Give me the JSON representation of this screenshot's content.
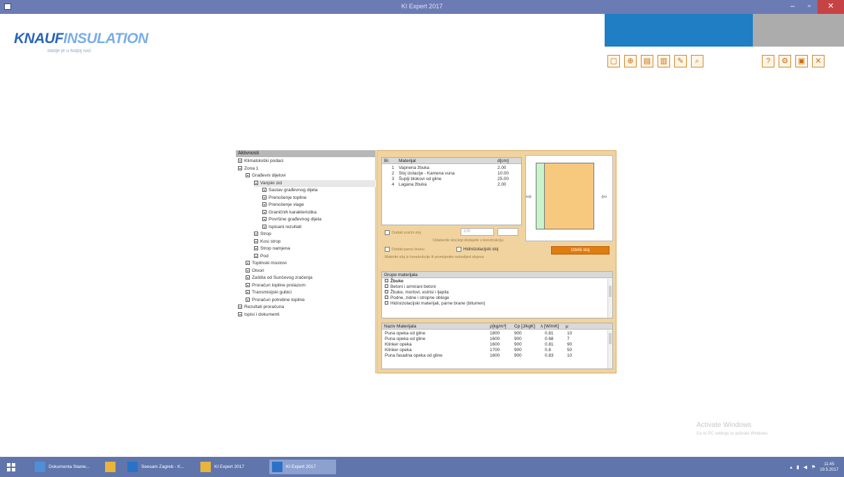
{
  "window": {
    "title": "KI Expert 2017",
    "min_glyph": "–",
    "max_glyph": "▫",
    "close_glyph": "✕"
  },
  "logo": {
    "brand_bold": "KNAUF",
    "brand_light": "INSULATION",
    "tagline": "swoje je u tvojoj ruci"
  },
  "toolbar": {
    "group1": [
      {
        "name": "new-icon",
        "glyph": "▢"
      },
      {
        "name": "open-icon",
        "glyph": "⊕"
      },
      {
        "name": "save-icon",
        "glyph": "▤"
      },
      {
        "name": "save-as-icon",
        "glyph": "▥"
      },
      {
        "name": "edit-icon",
        "glyph": "✎"
      },
      {
        "name": "preview-icon",
        "glyph": "⌕"
      }
    ],
    "group2": [
      {
        "name": "help-icon",
        "glyph": "?"
      },
      {
        "name": "settings-icon",
        "glyph": "⚙"
      },
      {
        "name": "pdf-icon",
        "glyph": "▣"
      },
      {
        "name": "exit-icon",
        "glyph": "✕"
      }
    ]
  },
  "tree": {
    "root": "Aktivnosti",
    "items": [
      {
        "label": "Klimatološki podaci",
        "level": 1
      },
      {
        "label": "Zona 1",
        "level": 1
      },
      {
        "label": "Građevni dijelovi",
        "level": 2
      },
      {
        "label": "Vanjski zid",
        "level": 3,
        "selected": true
      },
      {
        "label": "Sastav građevnog dijela",
        "level": 4
      },
      {
        "label": "Prenošenje topline",
        "level": 4
      },
      {
        "label": "Prenošenje vlage",
        "level": 4
      },
      {
        "label": "Graničnih karakteristika",
        "level": 4
      },
      {
        "label": "Površine građevnog dijela",
        "level": 4
      },
      {
        "label": "Ispisani rezultati",
        "level": 4
      },
      {
        "label": "Strop",
        "level": 3
      },
      {
        "label": "Kosi strop",
        "level": 3
      },
      {
        "label": "Strop namjena",
        "level": 3
      },
      {
        "label": "Pod",
        "level": 3
      },
      {
        "label": "Toplinski mostovi",
        "level": 2
      },
      {
        "label": "Otvori",
        "level": 2
      },
      {
        "label": "Zaštita od Sunčevog zračenja",
        "level": 2
      },
      {
        "label": "Proračun topline prolazom",
        "level": 2
      },
      {
        "label": "Transmisijski gubici",
        "level": 2
      },
      {
        "label": "Proračun potrebne topline",
        "level": 2
      },
      {
        "label": "Rezultati proračuna",
        "level": 1
      },
      {
        "label": "Ispisi i dokumenti",
        "level": 1
      }
    ]
  },
  "layers": {
    "headers": {
      "no": "Br.",
      "material": "Materijal",
      "thickness": "d[cm]"
    },
    "rows": [
      {
        "no": "1",
        "material": "Vapnena žbuka",
        "thickness": "2.00"
      },
      {
        "no": "2",
        "material": "Sloj izolacije - Kamena vuna",
        "thickness": "10.00"
      },
      {
        "no": "3",
        "material": "Šuplji blokovi od gline",
        "thickness": "25.00"
      },
      {
        "no": "4",
        "material": "Lagana žbuka",
        "thickness": "2.00"
      }
    ]
  },
  "options": {
    "option1": "Dodati zračni sloj",
    "option1_value": "100",
    "note1": "Odaberite sloj koji dodajete u konstrukciju",
    "option2": "Dodati parnu branu",
    "option3": "Hidroizolacijski sloj",
    "note2": "Maknite sloj iz konstrukcije ili promijenite redoslijed slojeva",
    "button": "Izbriši sloj"
  },
  "groups": {
    "header": "Grupe materijala",
    "items": [
      "Žbuke",
      "Betoni i armirani betoni",
      "Žbuke, mortovi, estrisi i ljepila",
      "Podne, zidne i stropne obloge",
      "Hidroizolacijski materijali, parne brane (bitumen)"
    ]
  },
  "materials": {
    "headers": {
      "name": "Naziv Materijala",
      "rho": "ρ[kg/m³]",
      "c": "Cp [J/kgK]",
      "lambda": "λ [W/mK]",
      "mu": "μ"
    },
    "rows": [
      {
        "name": "Puna opeka od gline",
        "rho": "1800",
        "c": "900",
        "lambda": "0.81",
        "mu": "10"
      },
      {
        "name": "Puna opeka od gline",
        "rho": "1600",
        "c": "900",
        "lambda": "0.68",
        "mu": "7"
      },
      {
        "name": "Klinker opeka",
        "rho": "1600",
        "c": "900",
        "lambda": "0.81",
        "mu": "90"
      },
      {
        "name": "Klinker opeka",
        "rho": "1700",
        "c": "900",
        "lambda": "0.8",
        "mu": "50"
      },
      {
        "name": "Puna fasadna opeka od gline",
        "rho": "1600",
        "c": "900",
        "lambda": "0.83",
        "mu": "10"
      }
    ]
  },
  "watermark": {
    "title": "Activate Windows",
    "subtitle": "Go to PC settings to activate Windows."
  },
  "taskbar": {
    "tasks": [
      {
        "label": "Dokumenta Stanie...",
        "active": false
      },
      {
        "label": "",
        "active": false
      },
      {
        "label": "Seesam Zagreb - K...",
        "active": false
      },
      {
        "label": "KI Expert 2017",
        "active": false
      },
      {
        "label": "KI Expert 2017",
        "active": true
      }
    ],
    "time": "11:45",
    "date": "19.5.2017"
  },
  "colors": {
    "accent_blue": "#1f7ec4",
    "accent_orange": "#e07d10",
    "panel_bg": "#f0d39f"
  }
}
